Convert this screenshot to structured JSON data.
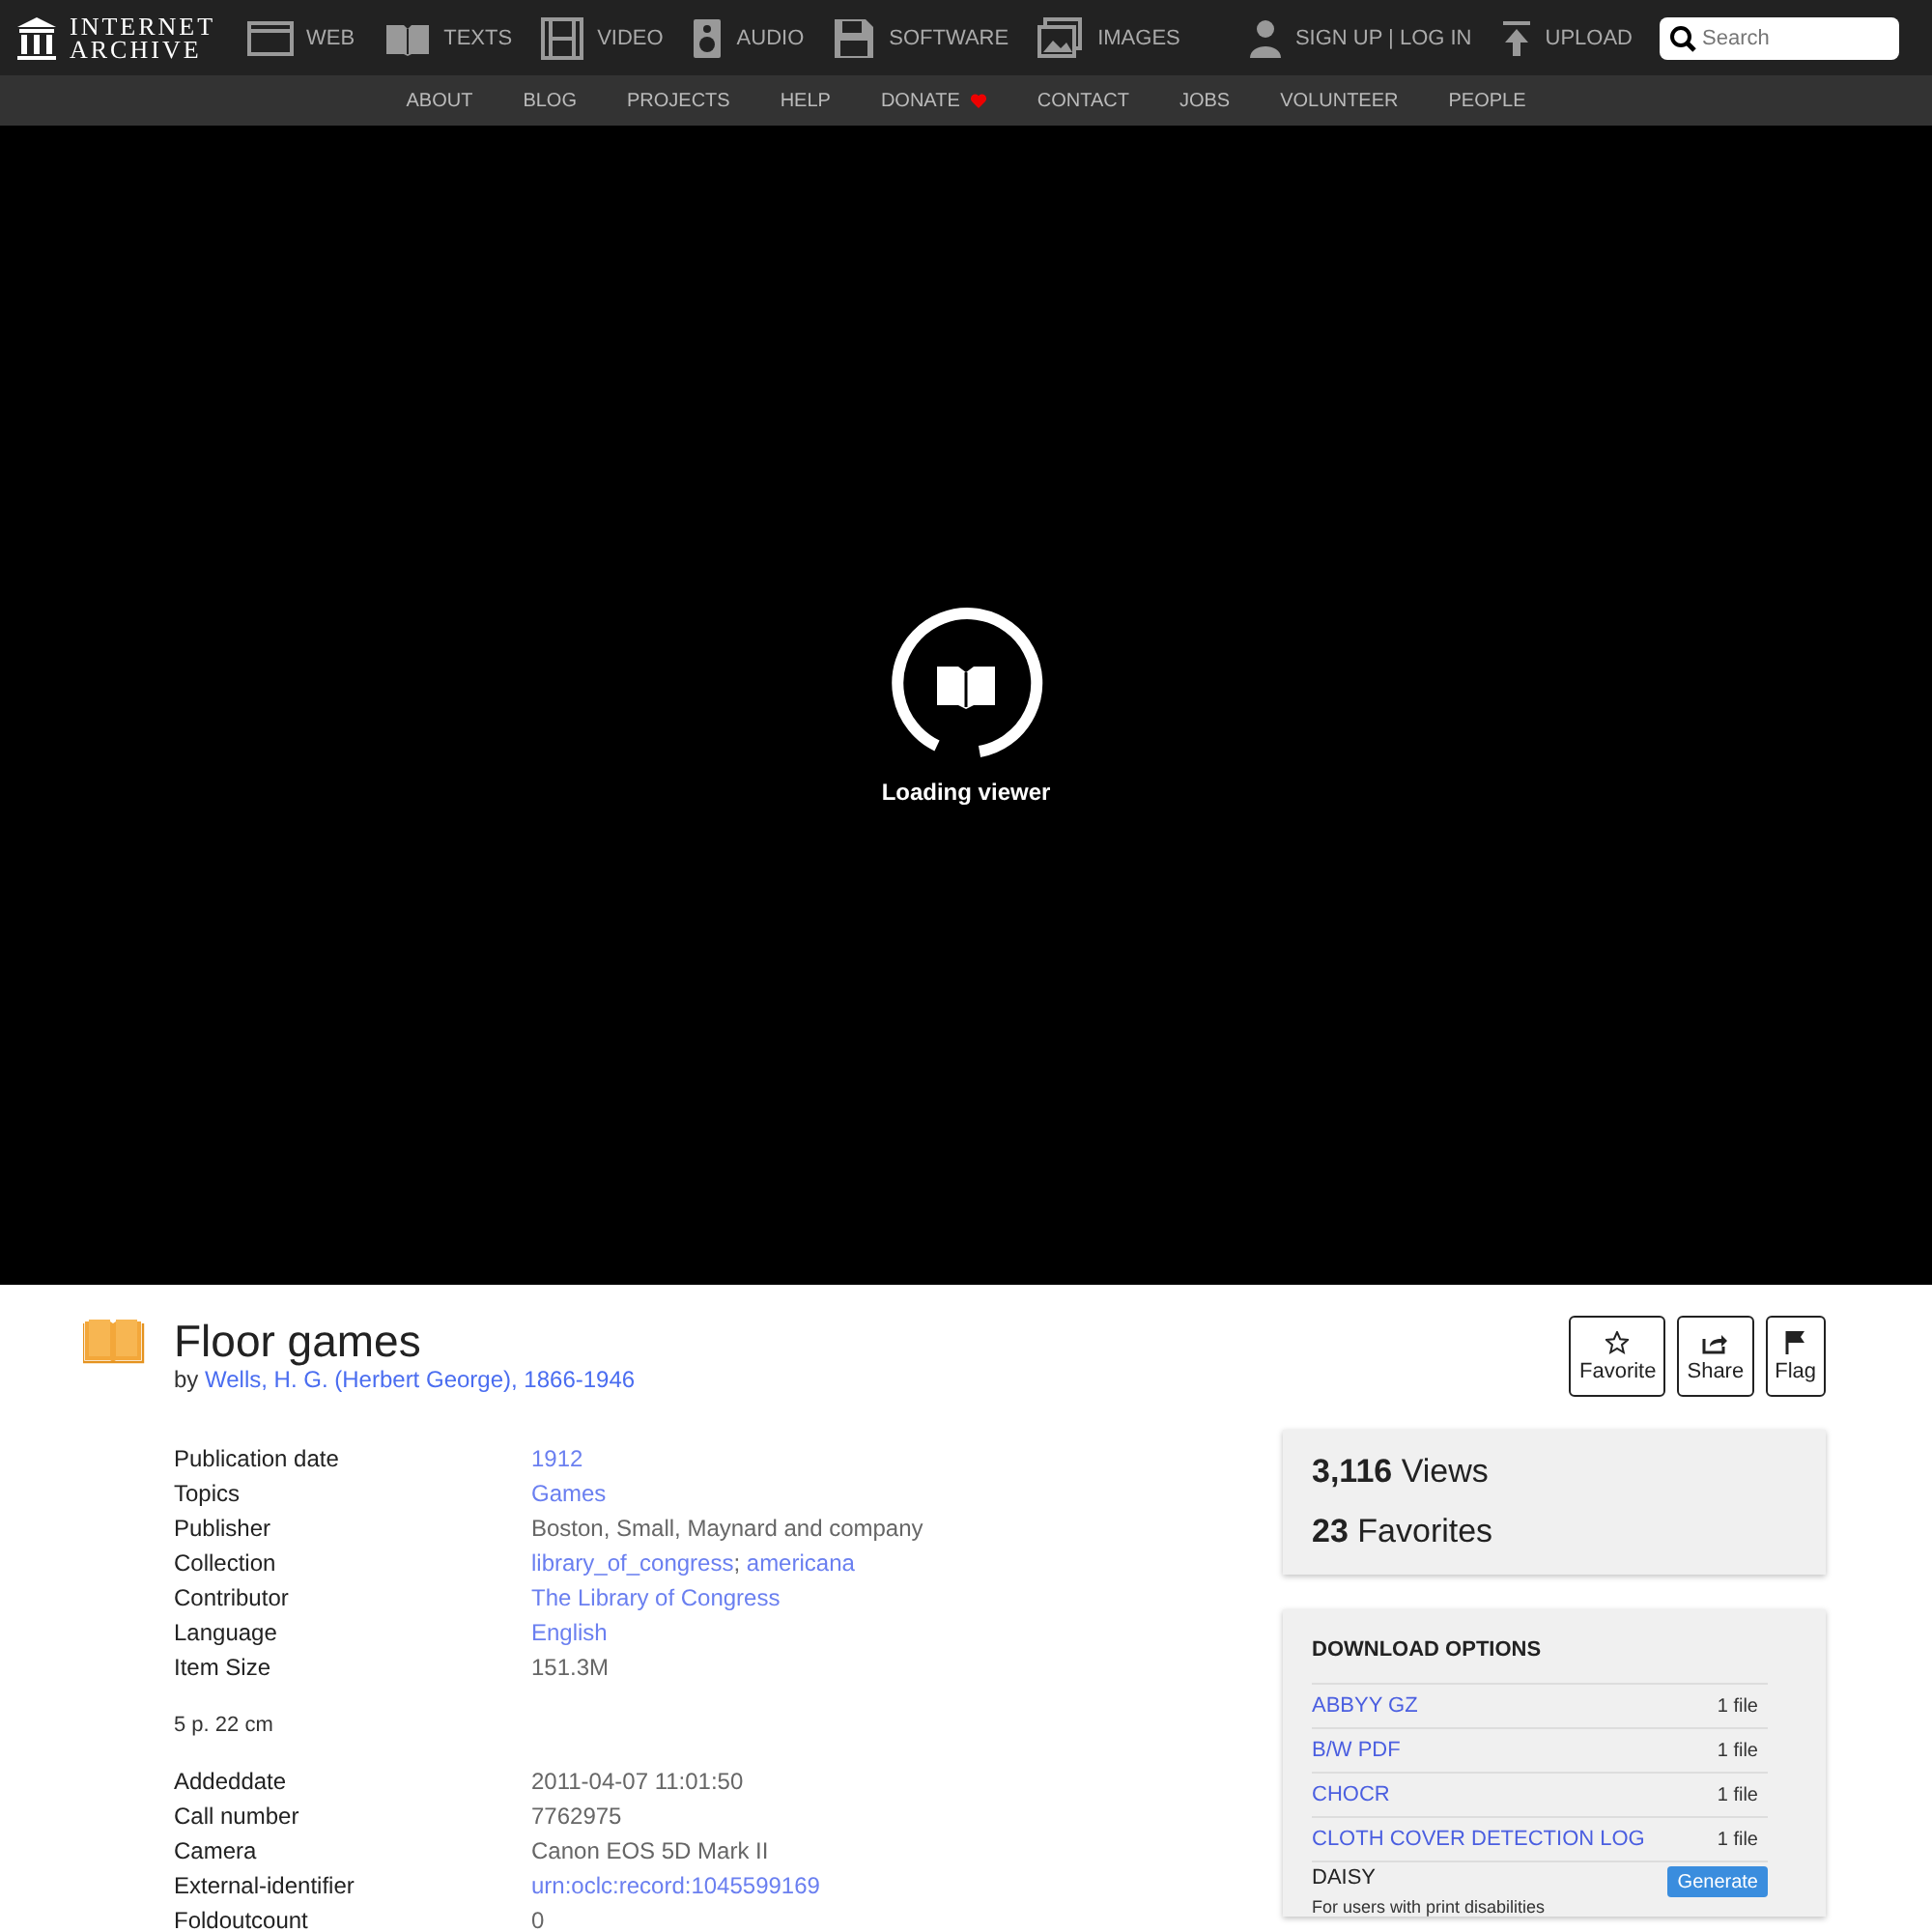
{
  "top_nav": {
    "logo": [
      "INTERNET",
      "ARCHIVE"
    ],
    "media": [
      {
        "kind": "web",
        "label": "WEB"
      },
      {
        "kind": "texts",
        "label": "TEXTS"
      },
      {
        "kind": "video",
        "label": "VIDEO"
      },
      {
        "kind": "audio",
        "label": "AUDIO"
      },
      {
        "kind": "software",
        "label": "SOFTWARE"
      },
      {
        "kind": "images",
        "label": "IMAGES"
      }
    ],
    "account": "SIGN UP | LOG IN",
    "upload": "UPLOAD",
    "search": {
      "placeholder": "Search"
    }
  },
  "sub_nav": [
    {
      "label": "ABOUT",
      "heart": false
    },
    {
      "label": "BLOG",
      "heart": false
    },
    {
      "label": "PROJECTS",
      "heart": false
    },
    {
      "label": "HELP",
      "heart": false
    },
    {
      "label": "DONATE",
      "heart": true
    },
    {
      "label": "CONTACT",
      "heart": false
    },
    {
      "label": "JOBS",
      "heart": false
    },
    {
      "label": "VOLUNTEER",
      "heart": false
    },
    {
      "label": "PEOPLE",
      "heart": false
    }
  ],
  "viewer": {
    "status": "Loading viewer"
  },
  "item": {
    "title": "Floor games",
    "by": "by",
    "author": "Wells, H. G. (Herbert George), 1866-1946",
    "actions": [
      {
        "kind": "favorite",
        "label": "Favorite"
      },
      {
        "kind": "share",
        "label": "Share"
      },
      {
        "kind": "flag",
        "label": "Flag"
      }
    ]
  },
  "metadata": [
    {
      "label": "Publication date",
      "values": [
        {
          "text": "1912",
          "link": true
        }
      ]
    },
    {
      "label": "Topics",
      "values": [
        {
          "text": "Games",
          "link": true
        }
      ]
    },
    {
      "label": "Publisher",
      "values": [
        {
          "text": "Boston, Small, Maynard and company",
          "link": false
        }
      ]
    },
    {
      "label": "Collection",
      "values": [
        {
          "text": "library_of_congress",
          "link": true
        },
        {
          "text": "; ",
          "link": false
        },
        {
          "text": "americana",
          "link": true
        }
      ]
    },
    {
      "label": "Contributor",
      "values": [
        {
          "text": "The Library of Congress",
          "link": true
        }
      ]
    },
    {
      "label": "Language",
      "values": [
        {
          "text": "English",
          "link": true
        }
      ]
    },
    {
      "label": "Item Size",
      "values": [
        {
          "text": "151.3M",
          "link": false
        }
      ]
    }
  ],
  "description": "5 p. 22 cm",
  "metadata_2": [
    {
      "label": "Addeddate",
      "values": [
        {
          "text": "2011-04-07 11:01:50",
          "link": false
        }
      ]
    },
    {
      "label": "Call number",
      "values": [
        {
          "text": "7762975",
          "link": false
        }
      ]
    },
    {
      "label": "Camera",
      "values": [
        {
          "text": "Canon EOS 5D Mark II",
          "link": false
        }
      ]
    },
    {
      "label": "External-identifier",
      "values": [
        {
          "text": "urn:oclc:record:1045599169",
          "link": true
        }
      ]
    },
    {
      "label": "Foldoutcount",
      "values": [
        {
          "text": "0",
          "link": false
        }
      ]
    }
  ],
  "stats": [
    {
      "number": "3,116",
      "label": "Views"
    },
    {
      "number": "23",
      "label": "Favorites"
    }
  ],
  "downloads": {
    "title": "DOWNLOAD OPTIONS",
    "items": [
      {
        "kind": "file",
        "name": "ABBYY GZ",
        "count": "1 file"
      },
      {
        "kind": "file",
        "name": "B/W PDF",
        "count": "1 file"
      },
      {
        "kind": "file",
        "name": "CHOCR",
        "count": "1 file"
      },
      {
        "kind": "file",
        "name": "CLOTH COVER DETECTION LOG",
        "count": "1 file"
      },
      {
        "kind": "generate",
        "name": "DAISY",
        "button": "Generate",
        "note": "For users with print disabilities"
      }
    ]
  }
}
